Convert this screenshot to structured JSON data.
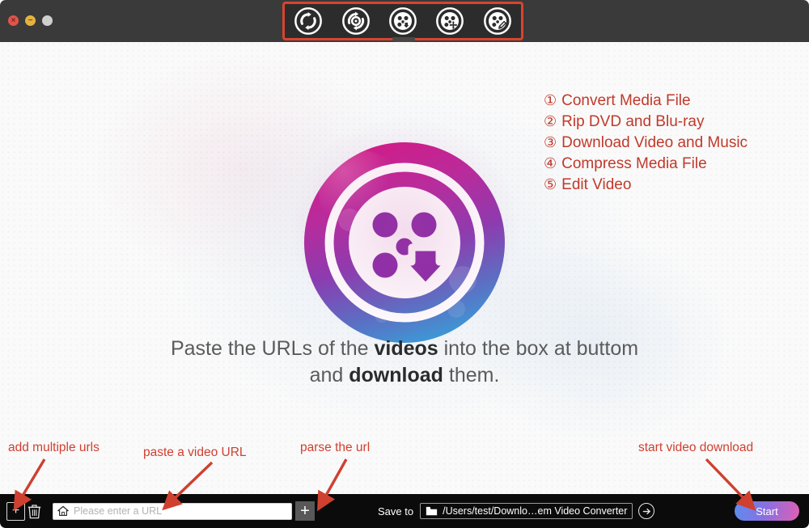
{
  "window": {
    "controls": [
      {
        "name": "close",
        "glyph": "×",
        "color": "#e1544a"
      },
      {
        "name": "minimize",
        "glyph": "−",
        "color": "#e3b341"
      },
      {
        "name": "maximize",
        "glyph": "",
        "color": "#cfcfcf"
      }
    ]
  },
  "toolbar": {
    "highlight_color": "#d8442e",
    "buttons": [
      {
        "icon": "convert-icon",
        "number": "①",
        "tooltip": "Convert Media File"
      },
      {
        "icon": "rip-dvd-icon",
        "number": "②",
        "tooltip": "Rip DVD and Blu-ray"
      },
      {
        "icon": "download-icon",
        "number": "③",
        "tooltip": "Download Video and Music"
      },
      {
        "icon": "compress-icon",
        "number": "④",
        "tooltip": "Compress Media File"
      },
      {
        "icon": "edit-icon",
        "number": "⑤",
        "tooltip": "Edit Video"
      }
    ]
  },
  "features": {
    "color": "#c0392b",
    "items": [
      {
        "num": "①",
        "label": "Convert Media File"
      },
      {
        "num": "②",
        "label": "Rip DVD and Blu-ray"
      },
      {
        "num": "③",
        "label": "Download Video and Music"
      },
      {
        "num": "④",
        "label": "Compress Media File"
      },
      {
        "num": "⑤",
        "label": "Edit Video"
      }
    ]
  },
  "logo": {
    "name": "app-logo",
    "gradient_top": "#d4268e",
    "gradient_mid": "#8b3bb0",
    "gradient_bottom": "#3b8fd4"
  },
  "instruction": {
    "line1_part1": "Paste the URLs of the ",
    "line1_bold": "videos",
    "line1_part2": " into the box at buttom",
    "line2_part1": "and ",
    "line2_bold": "download",
    "line2_part2": " them."
  },
  "annotations": {
    "color": "#cf4030",
    "add_urls": "add multiple urls",
    "paste_url": "paste a video URL",
    "parse_url": "parse the url",
    "start_download": "start video download"
  },
  "bottombar": {
    "add_button_glyph": "+",
    "delete_icon": "trash-icon",
    "url_placeholder": "Please enter a URL",
    "url_value": "",
    "home_icon": "home-icon",
    "parse_button_glyph": "+",
    "save_to_label": "Save to",
    "save_path": "/Users/test/Downlo…em Video Converter",
    "go_icon": "arrow-right-icon",
    "start_label": "Start"
  }
}
